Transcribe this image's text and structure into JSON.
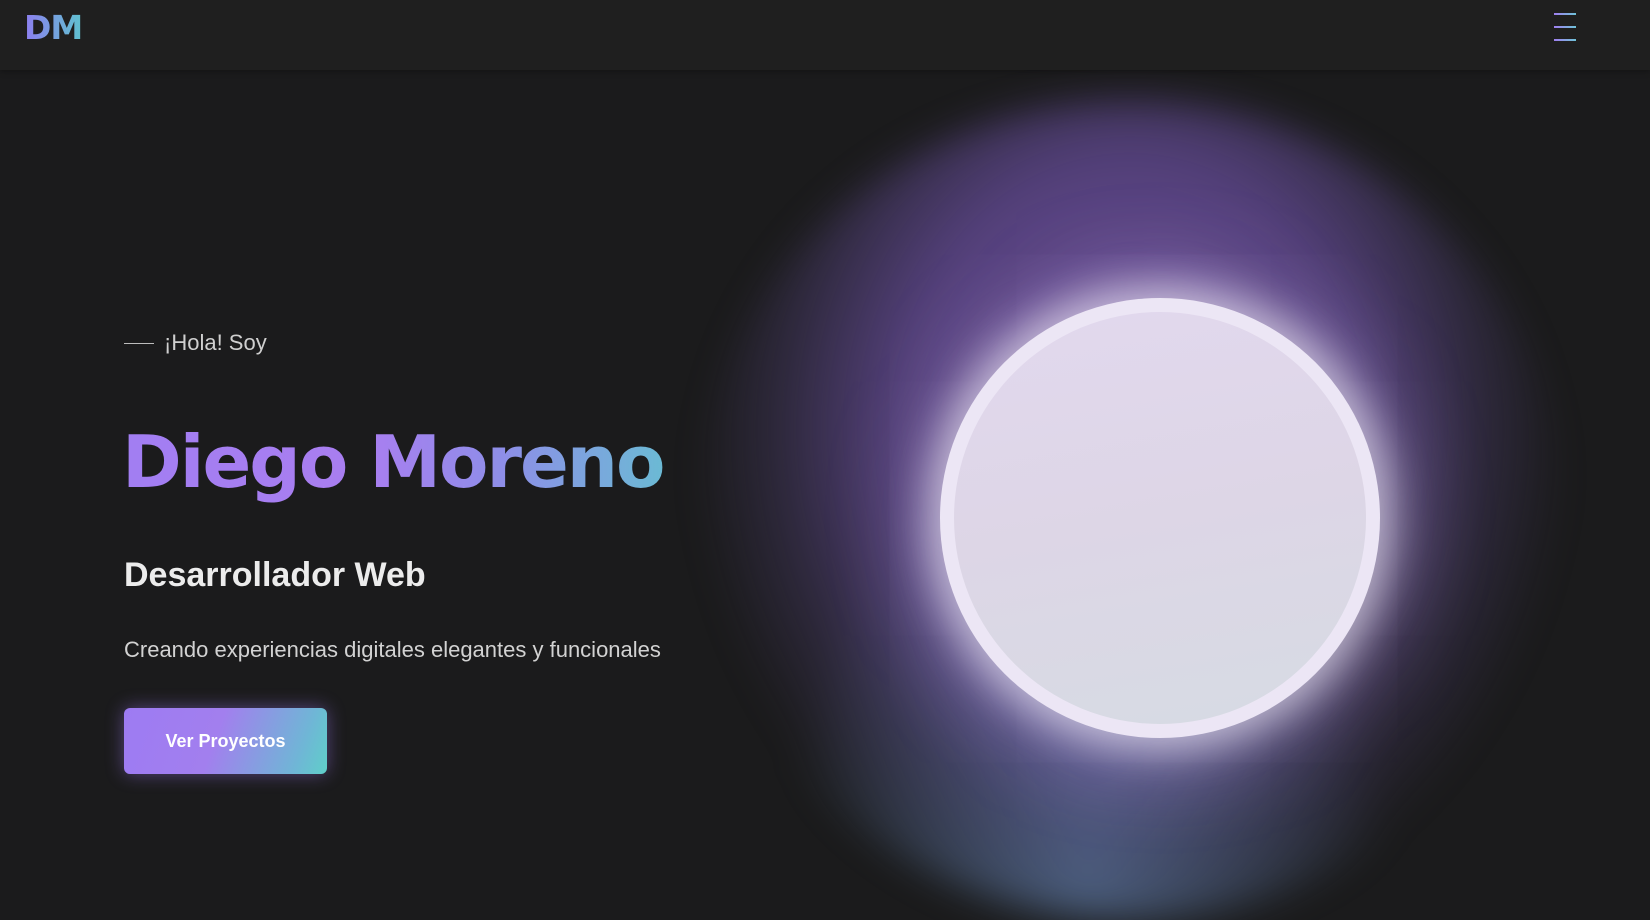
{
  "nav": {
    "logo": "DM",
    "menu_icon": "hamburger-menu-icon"
  },
  "hero": {
    "greeting": "¡Hola! Soy",
    "name": "Diego Moreno",
    "role": "Desarrollador Web",
    "tagline": "Creando experiencias digitales elegantes y funcionales",
    "cta_label": "Ver Proyectos"
  },
  "colors": {
    "background": "#1b1b1c",
    "navbar": "#1f1f1f",
    "accent_purple": "#a27ef2",
    "accent_teal": "#5fcfc9"
  }
}
